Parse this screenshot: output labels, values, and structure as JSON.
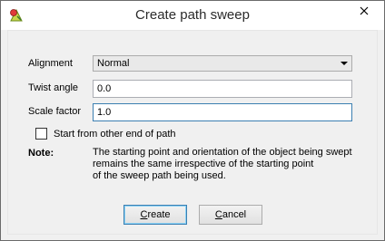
{
  "window": {
    "title": "Create path sweep",
    "app_icon": "app-icon",
    "close_icon": "close-icon"
  },
  "form": {
    "alignment": {
      "label": "Alignment",
      "selected": "Normal"
    },
    "twist_angle": {
      "label": "Twist angle",
      "value": "0.0"
    },
    "scale_factor": {
      "label": "Scale factor",
      "value": "1.0"
    },
    "start_other_end": {
      "label": "Start from other end of path",
      "checked": false
    }
  },
  "note": {
    "label": "Note:",
    "lines": [
      "The starting point and orientation of the object being swept",
      "remains the same irrespective of the starting point",
      "of the sweep path being used."
    ]
  },
  "buttons": {
    "create": {
      "mnemonic": "C",
      "rest": "reate"
    },
    "cancel": {
      "mnemonic": "C",
      "rest": "ancel"
    }
  }
}
